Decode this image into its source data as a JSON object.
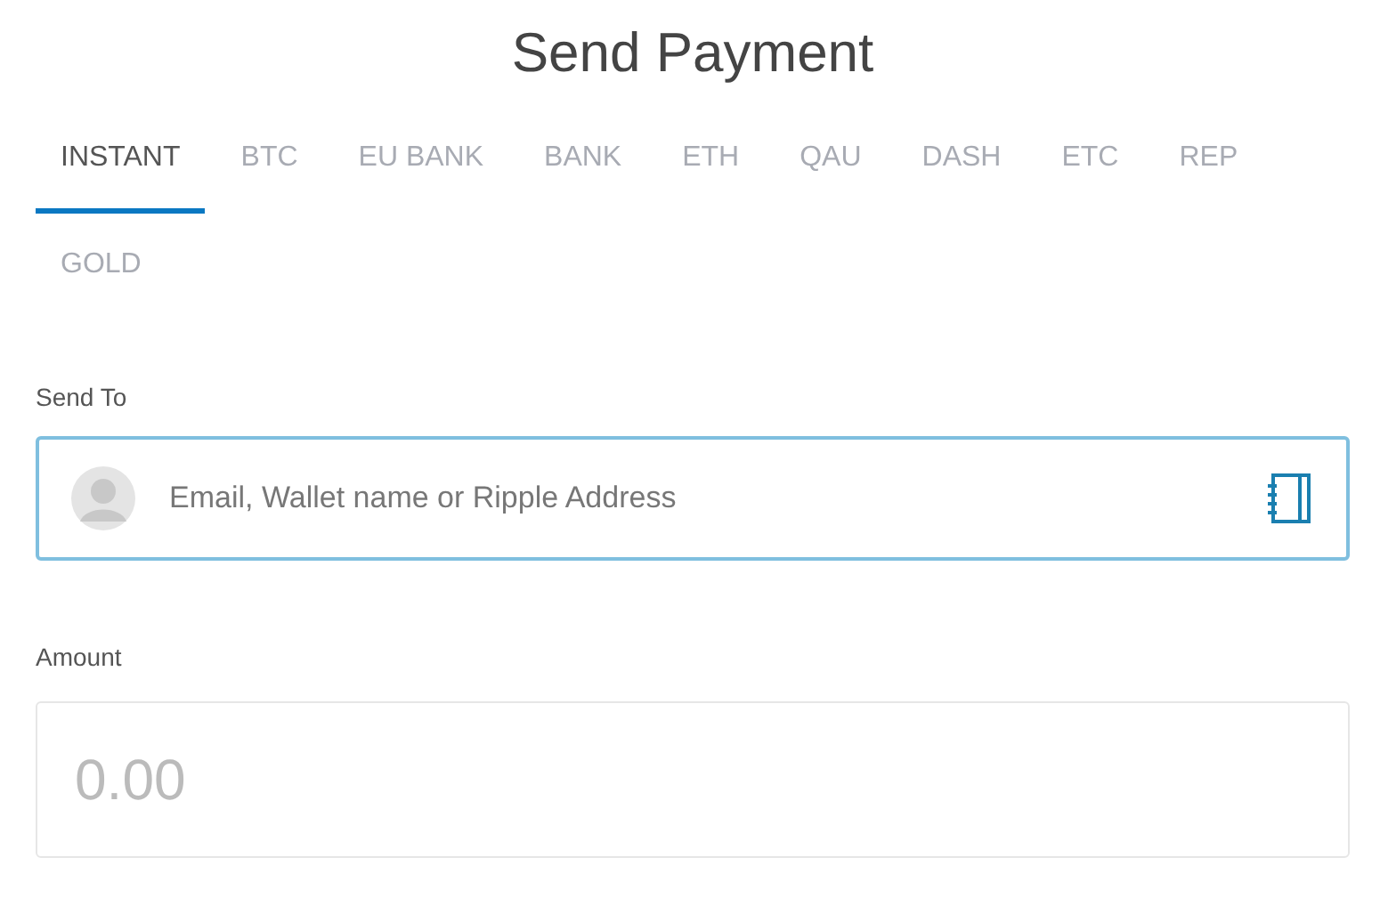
{
  "title": "Send Payment",
  "tabs": [
    {
      "label": "INSTANT",
      "selected": true
    },
    {
      "label": "BTC",
      "selected": false
    },
    {
      "label": "EU BANK",
      "selected": false
    },
    {
      "label": "BANK",
      "selected": false
    },
    {
      "label": "ETH",
      "selected": false
    },
    {
      "label": "QAU",
      "selected": false
    },
    {
      "label": "DASH",
      "selected": false
    },
    {
      "label": "ETC",
      "selected": false
    },
    {
      "label": "REP",
      "selected": false
    },
    {
      "label": "GOLD",
      "selected": false
    }
  ],
  "send_to": {
    "label": "Send To",
    "placeholder": "Email, Wallet name or Ripple Address",
    "focused": true
  },
  "amount": {
    "label": "Amount",
    "placeholder": "0.00",
    "focused": false
  }
}
